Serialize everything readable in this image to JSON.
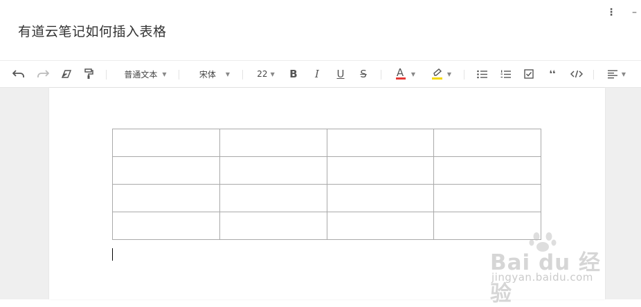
{
  "document": {
    "title": "有道云笔记如何插入表格"
  },
  "window_controls": {
    "more_glyph": "⋮",
    "minimize_glyph": "–"
  },
  "toolbar": {
    "paragraph_style": "普通文本",
    "font_family": "宋体",
    "font_size": "22",
    "bold_label": "B",
    "italic_label": "I",
    "underline_label": "U",
    "strike_label": "S",
    "font_color_label": "A",
    "font_color": "#e53935",
    "highlight_color": "#f5d800",
    "quote_label": "❛❛",
    "caret": "▼"
  },
  "table": {
    "rows": 4,
    "columns": 4,
    "cells": [
      [
        "",
        "",
        "",
        ""
      ],
      [
        "",
        "",
        "",
        ""
      ],
      [
        "",
        "",
        "",
        ""
      ],
      [
        "",
        "",
        "",
        ""
      ]
    ]
  },
  "watermark": {
    "brand": "Bai du 经验",
    "url": "jingyan.baidu.com"
  }
}
